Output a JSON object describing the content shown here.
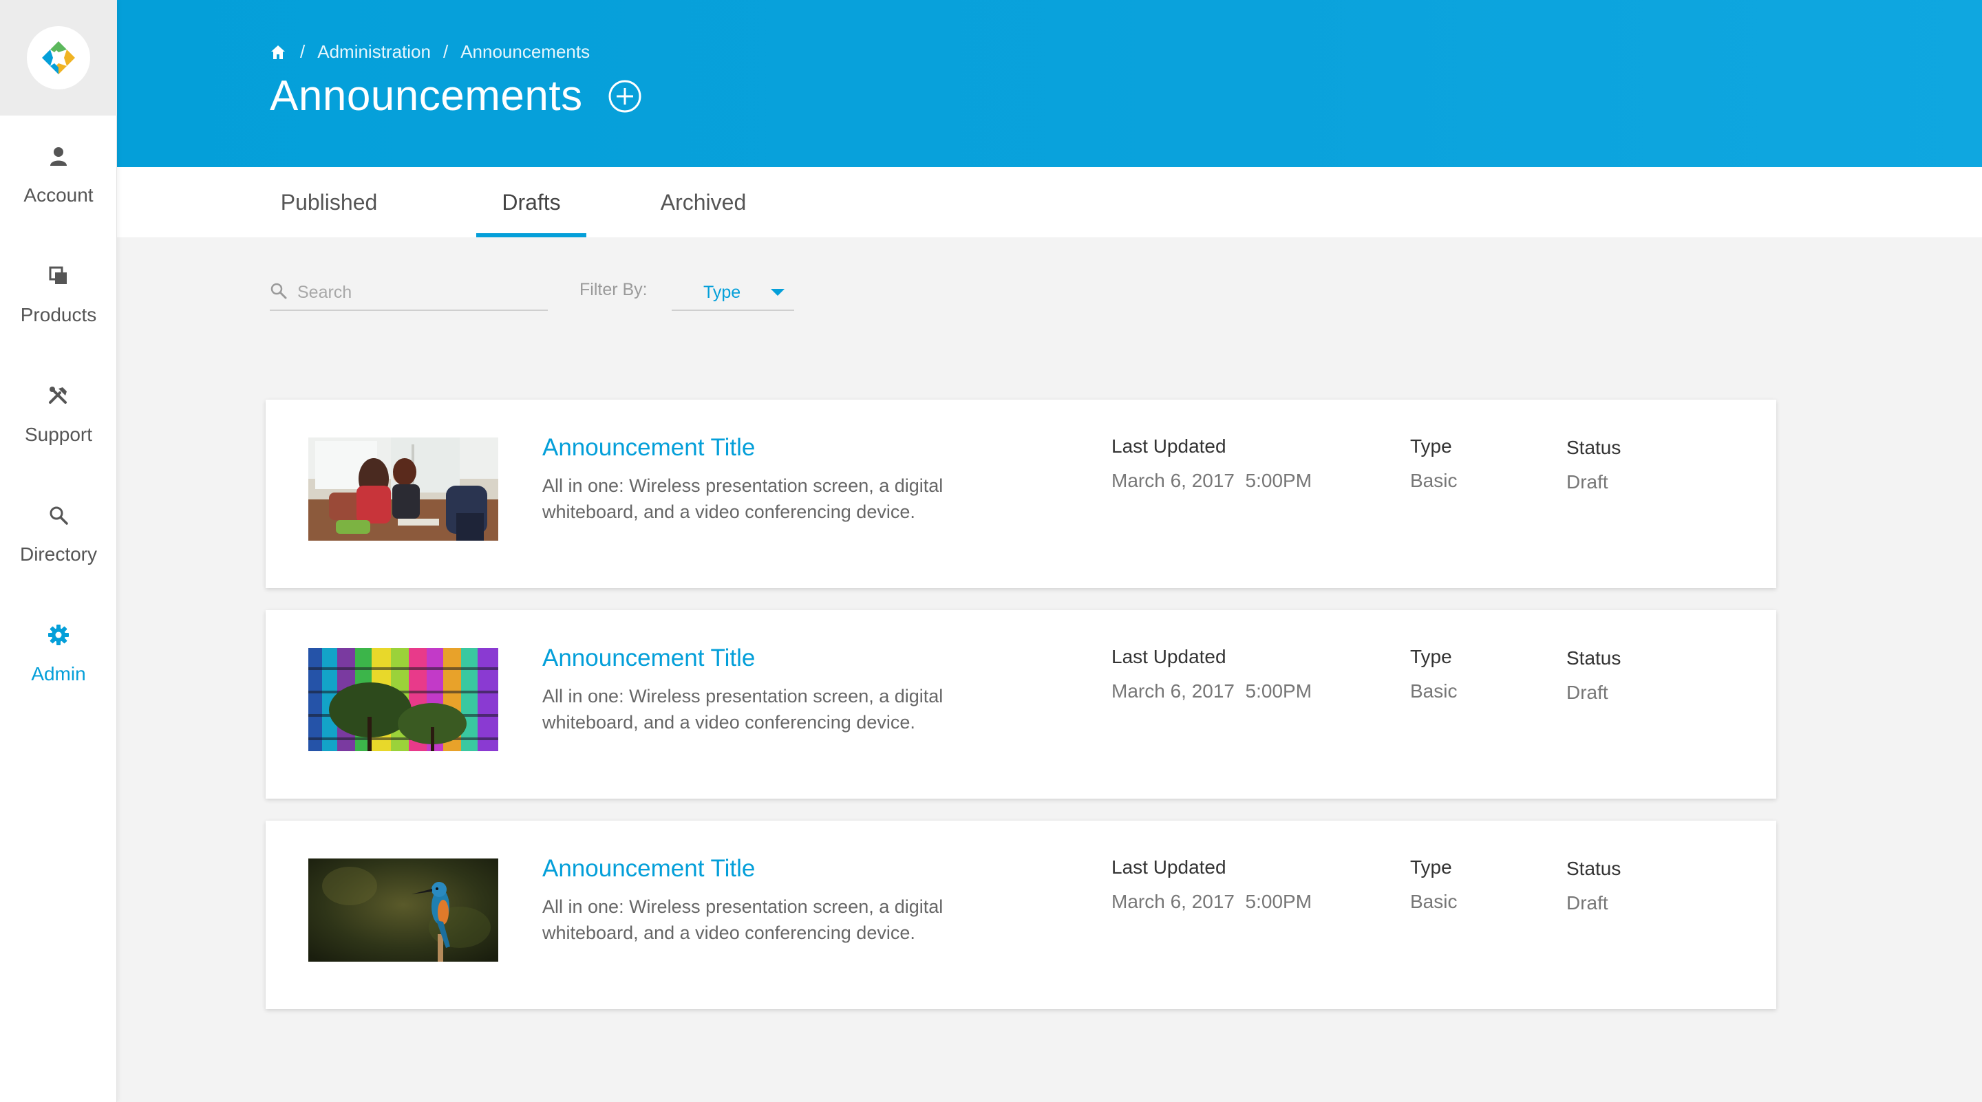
{
  "sidebar": {
    "logo": "app-logo",
    "items": [
      {
        "label": "Account",
        "icon": "person-icon",
        "active": false
      },
      {
        "label": "Products",
        "icon": "products-icon",
        "active": false
      },
      {
        "label": "Support",
        "icon": "tools-icon",
        "active": false
      },
      {
        "label": "Directory",
        "icon": "search-icon",
        "active": false
      },
      {
        "label": "Admin",
        "icon": "gear-icon",
        "active": true
      }
    ]
  },
  "header": {
    "breadcrumb": [
      "Administration",
      "Announcements"
    ],
    "breadcrumb_separator": "/",
    "title": "Announcements"
  },
  "tabs": [
    {
      "label": "Published",
      "active": false
    },
    {
      "label": "Drafts",
      "active": true
    },
    {
      "label": "Archived",
      "active": false
    }
  ],
  "filters": {
    "search_placeholder": "Search",
    "filter_label": "Filter By:",
    "filter_value": "Type"
  },
  "columns": {
    "updated": "Last Updated",
    "type": "Type",
    "status": "Status"
  },
  "announcements": [
    {
      "image": "office-meeting-photo",
      "title": "Announcement Title",
      "description": "All in one: Wireless presentation screen, a digital whiteboard, and a video conferencing device.",
      "updated": "March 6, 2017  5:00PM",
      "type": "Basic",
      "status": "Draft"
    },
    {
      "image": "colorful-building-photo",
      "title": "Announcement Title",
      "description": "All in one: Wireless presentation screen, a digital whiteboard, and a video conferencing device.",
      "updated": "March 6, 2017  5:00PM",
      "type": "Basic",
      "status": "Draft"
    },
    {
      "image": "kingfisher-bird-photo",
      "title": "Announcement Title",
      "description": "All in one: Wireless presentation screen, a digital whiteboard, and a video conferencing device.",
      "updated": "March 6, 2017  5:00PM",
      "type": "Basic",
      "status": "Draft"
    }
  ],
  "colors": {
    "accent": "#049fd9",
    "background": "#f3f3f3",
    "card": "#ffffff"
  }
}
